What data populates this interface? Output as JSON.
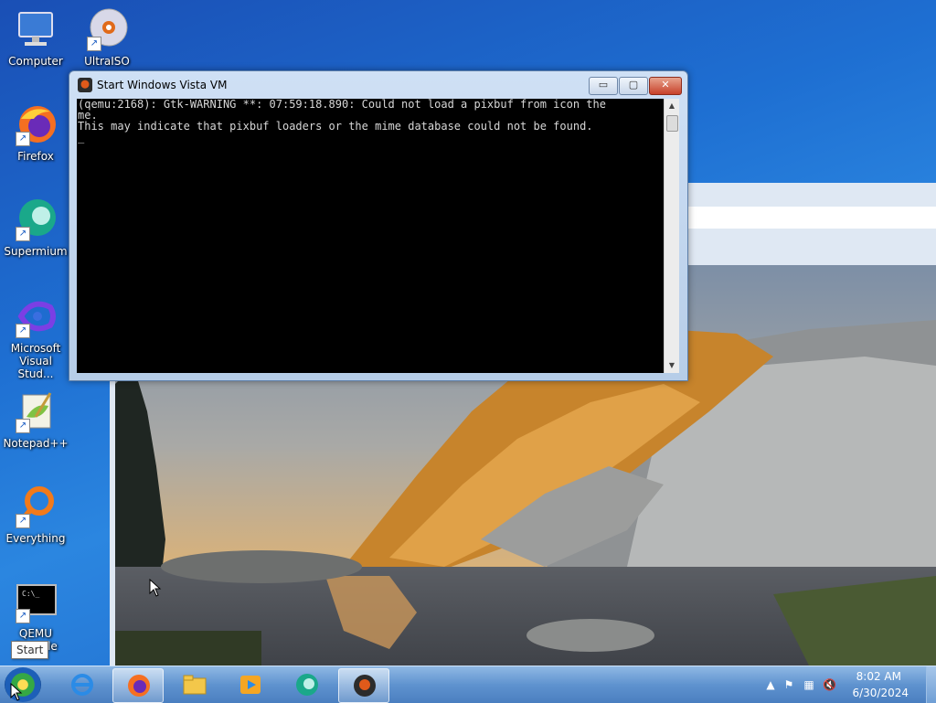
{
  "desktop": {
    "icons": [
      {
        "label": "Computer"
      },
      {
        "label": "UltraISO"
      },
      {
        "label": "Firefox"
      },
      {
        "label": "Supermium"
      },
      {
        "label": "Microsoft Visual Stud..."
      },
      {
        "label": "Notepad++"
      },
      {
        "label": "Everything"
      },
      {
        "label": "QEMU Console"
      }
    ]
  },
  "console_window": {
    "title": "Start Windows Vista VM",
    "lines": [
      "(qemu:2168): Gtk-WARNING **: 07:59:18.890: Could not load a pixbuf from icon the",
      "me.",
      "This may indicate that pixbuf loaders or the mime database could not be found.",
      "_"
    ],
    "buttons": {
      "minimize": "▭",
      "maximize": "▢",
      "close": "✕"
    }
  },
  "tooltip": {
    "text": "Start"
  },
  "taskbar": {
    "items": [
      "internet-explorer",
      "firefox",
      "file-explorer",
      "media-player",
      "supermium",
      "qemu"
    ],
    "active_item": "qemu",
    "clock": {
      "time": "8:02 AM",
      "date": "6/30/2024"
    }
  },
  "colors": {
    "accent": "#1e6fd2",
    "taskbar": "#5f93cf",
    "console_bg": "#000000"
  }
}
